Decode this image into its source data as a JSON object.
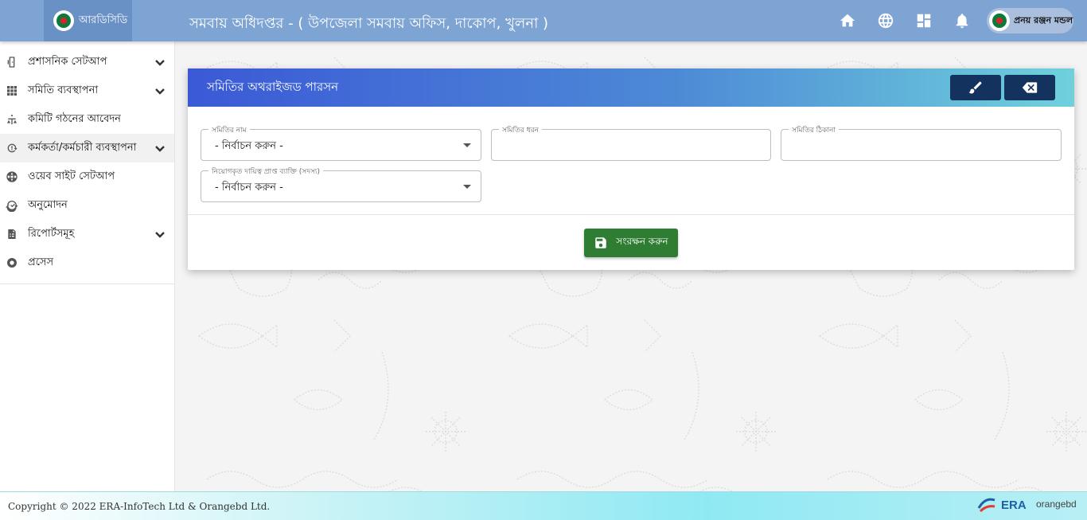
{
  "header": {
    "brand_name": "আরডিসিডি",
    "office_title": "সমবায় অধিদপ্তর - ( উপজেলা সমবায় অফিস, দাকোপ, খুলনা )",
    "icons": [
      "home-icon",
      "globe-icon",
      "dashboard-icon",
      "bell-icon"
    ],
    "user_name": "প্রনয় রঞ্জন মন্ডল"
  },
  "sidebar": {
    "items": [
      {
        "label": "প্রশাসনিক সেটআপ",
        "icon": "admin-setup-icon",
        "expandable": true
      },
      {
        "label": "সমিতি ব্যবস্থাপনা",
        "icon": "grid-icon",
        "expandable": true
      },
      {
        "label": "কমিটি গঠনের আবেদন",
        "icon": "committee-icon",
        "expandable": false
      },
      {
        "label": "কর্মকর্তা/কর্মচারী ব্যবস্থাপনা",
        "icon": "staff-icon",
        "expandable": true,
        "active": true
      },
      {
        "label": "ওয়েব সাইট সেটআপ",
        "icon": "globe-icon",
        "expandable": false
      },
      {
        "label": "অনুমোদন",
        "icon": "approval-icon",
        "expandable": false
      },
      {
        "label": "রিপোর্টসমূহ",
        "icon": "report-icon",
        "expandable": true
      },
      {
        "label": "প্রসেস",
        "icon": "process-icon",
        "expandable": false
      }
    ]
  },
  "form": {
    "title": "সমিতির অথরাইজড পারসন",
    "fields": {
      "samity_name": {
        "label": "সমিতির নাম",
        "value": "- নির্বাচন করুন -"
      },
      "samity_type": {
        "label": "সমিতির ধরন",
        "value": ""
      },
      "samity_address": {
        "label": "সমিতির ঠিকানা",
        "value": ""
      },
      "authorized_person": {
        "label": "নিয়োগকৃত দায়িত্ব প্রাপ্ত ব্যাক্তি (সদস্য)",
        "value": "- নির্বাচন করুন -"
      }
    },
    "save_label": "সংরক্ষন করুন"
  },
  "footer": {
    "copyright": "Copyright © 2022 ERA-InfoTech Ltd & Orangebd Ltd.",
    "era_logo_text": "ERA",
    "orange_logo_text": "orangebd"
  },
  "colors": {
    "header_bg": "#7ea4d4",
    "card_header_start": "#3b59d6",
    "card_header_end": "#6fd1dc",
    "header_button": "#13325e",
    "save_button": "#2e7d32"
  }
}
